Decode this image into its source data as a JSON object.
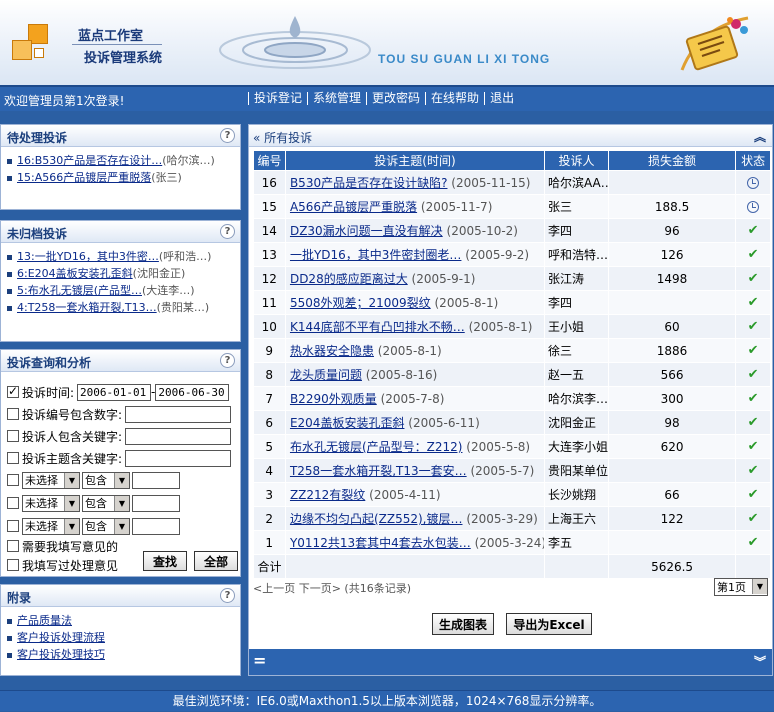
{
  "header": {
    "studio": "蓝点工作室",
    "system_name": "投诉管理系统",
    "pinyin": "TOU SU GUAN LI XI TONG"
  },
  "nav": {
    "welcome": "欢迎管理员第1次登录!",
    "menu": [
      "投诉登记",
      "系统管理",
      "更改密码",
      "在线帮助",
      "退出"
    ]
  },
  "pending": {
    "title": "待处理投诉",
    "items": [
      {
        "label": "16:B530产品是否存在设计…",
        "meta": "(哈尔滨…)"
      },
      {
        "label": "15:A566产品镀层严重脱落",
        "meta": "(张三)"
      }
    ]
  },
  "unfiled": {
    "title": "未归档投诉",
    "items": [
      {
        "label": "13:一批YD16，其中3件密…",
        "meta": "(呼和浩…)"
      },
      {
        "label": "6:E204盖板安装孔歪斜",
        "meta": "(沈阳金正)"
      },
      {
        "label": "5:布水孔无镀层(产品型…",
        "meta": "(大连李…)"
      },
      {
        "label": "4:T258一套水箱开裂,T13…",
        "meta": "(贵阳某…)"
      }
    ]
  },
  "query": {
    "title": "投诉查询和分析",
    "time_label": "投诉时间:",
    "date_from": "2006-01-01",
    "date_sep": "-",
    "date_to": "2006-06-30",
    "id_label": "投诉编号包含数字:",
    "person_label": "投诉人包含关键字:",
    "subject_label": "投诉主题含关键字:",
    "field_select": "未选择",
    "op_select": "包含",
    "need_opinion": "需要我填写意见的",
    "done_opinion": "我填写过处理意见",
    "find_button": "查找",
    "all_button": "全部"
  },
  "appendix": {
    "title": "附录",
    "links": [
      "产品质量法",
      "客户投诉处理流程",
      "客户投诉处理技巧"
    ]
  },
  "main": {
    "title": "所有投诉",
    "columns": [
      "编号",
      "投诉主题(时间)",
      "投诉人",
      "损失金额",
      "状态"
    ],
    "rows": [
      {
        "id": "16",
        "subject": "B530产品是否存在设计缺陷?",
        "date": "(2005-11-15)",
        "person": "哈尔滨AA…",
        "amount": "",
        "status": "pending"
      },
      {
        "id": "15",
        "subject": "A566产品镀层严重脱落",
        "date": "(2005-11-7)",
        "person": "张三",
        "amount": "188.5",
        "status": "pending"
      },
      {
        "id": "14",
        "subject": "DZ30漏水问题一直没有解决",
        "date": "(2005-10-2)",
        "person": "李四",
        "amount": "96",
        "status": "done"
      },
      {
        "id": "13",
        "subject": "一批YD16，其中3件密封圈老…",
        "date": "(2005-9-2)",
        "person": "呼和浩特…",
        "amount": "126",
        "status": "done"
      },
      {
        "id": "12",
        "subject": "DD28的感应距离过大",
        "date": "(2005-9-1)",
        "person": "张江涛",
        "amount": "1498",
        "status": "done"
      },
      {
        "id": "11",
        "subject": "5508外观差；21009裂纹",
        "date": "(2005-8-1)",
        "person": "李四",
        "amount": "",
        "status": "done"
      },
      {
        "id": "10",
        "subject": "K144底部不平有凸凹排水不畅…",
        "date": "(2005-8-1)",
        "person": "王小姐",
        "amount": "60",
        "status": "done"
      },
      {
        "id": "9",
        "subject": "热水器安全隐患",
        "date": "(2005-8-1)",
        "person": "徐三",
        "amount": "1886",
        "status": "done"
      },
      {
        "id": "8",
        "subject": "龙头质量问题",
        "date": "(2005-8-16)",
        "person": "赵一五",
        "amount": "566",
        "status": "done"
      },
      {
        "id": "7",
        "subject": "B2290外观质量",
        "date": "(2005-7-8)",
        "person": "哈尔滨李…",
        "amount": "300",
        "status": "done"
      },
      {
        "id": "6",
        "subject": "E204盖板安装孔歪斜",
        "date": "(2005-6-11)",
        "person": "沈阳金正",
        "amount": "98",
        "status": "done"
      },
      {
        "id": "5",
        "subject": "布水孔无镀层(产品型号：Z212)",
        "date": "(2005-5-8)",
        "person": "大连李小姐",
        "amount": "620",
        "status": "done"
      },
      {
        "id": "4",
        "subject": "T258一套水箱开裂,T13一套安…",
        "date": "(2005-5-7)",
        "person": "贵阳某单位",
        "amount": "",
        "status": "done"
      },
      {
        "id": "3",
        "subject": "ZZ212有裂纹",
        "date": "(2005-4-11)",
        "person": "长沙姚翔",
        "amount": "66",
        "status": "done"
      },
      {
        "id": "2",
        "subject": "边缘不均匀凸起(ZZ552),镀层…",
        "date": "(2005-3-29)",
        "person": "上海王六",
        "amount": "122",
        "status": "done"
      },
      {
        "id": "1",
        "subject": "Y0112共13套其中4套去水包装…",
        "date": "(2005-3-24)",
        "person": "李五",
        "amount": "",
        "status": "done"
      }
    ],
    "total_label": "合计",
    "total_amount": "5626.5",
    "pager_text": "<上一页 下一页> (共16条记录)",
    "page_select": "第1页",
    "chart_button": "生成图表",
    "excel_button": "导出为Excel"
  },
  "footer": {
    "text": "最佳浏览环境：IE6.0或Maxthon1.5以上版本浏览器，1024×768显示分辨率。"
  },
  "colors": {
    "nav_blue": "#2c64b0",
    "panel_border": "#9db3d6",
    "link": "#0a2a8a",
    "done_green": "#2a9a2a"
  }
}
